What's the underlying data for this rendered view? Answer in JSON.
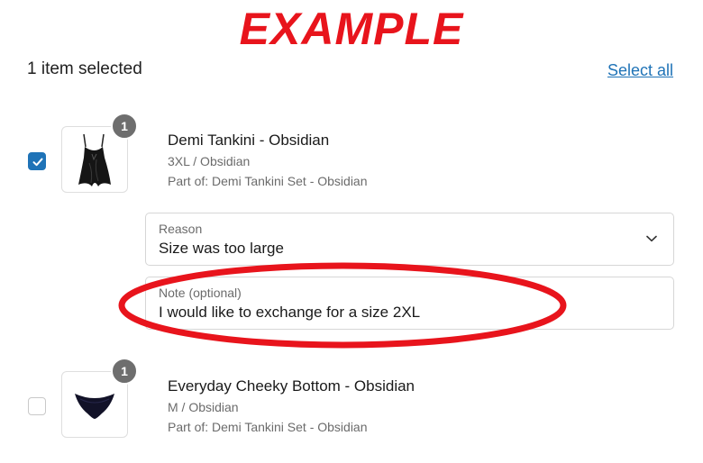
{
  "banner": {
    "text": "EXAMPLE",
    "color": "#e8141c"
  },
  "header": {
    "selected_count": "1 item selected",
    "select_all": "Select all"
  },
  "items": [
    {
      "badge": "1",
      "checked": true,
      "title": "Demi Tankini - Obsidian",
      "variant": "3XL / Obsidian",
      "part_of": "Part of: Demi Tankini Set - Obsidian",
      "image": "black-tankini-top",
      "reason": {
        "label": "Reason",
        "value": "Size was too large"
      },
      "note": {
        "label": "Note (optional)",
        "value": "I would like to exchange for a size 2XL"
      }
    },
    {
      "badge": "1",
      "checked": false,
      "title": "Everyday Cheeky Bottom - Obsidian",
      "variant": "M / Obsidian",
      "part_of": "Part of: Demi Tankini Set - Obsidian",
      "image": "black-bikini-bottom"
    }
  ],
  "colors": {
    "accent": "#1f73b7",
    "highlight": "#e8141c"
  }
}
